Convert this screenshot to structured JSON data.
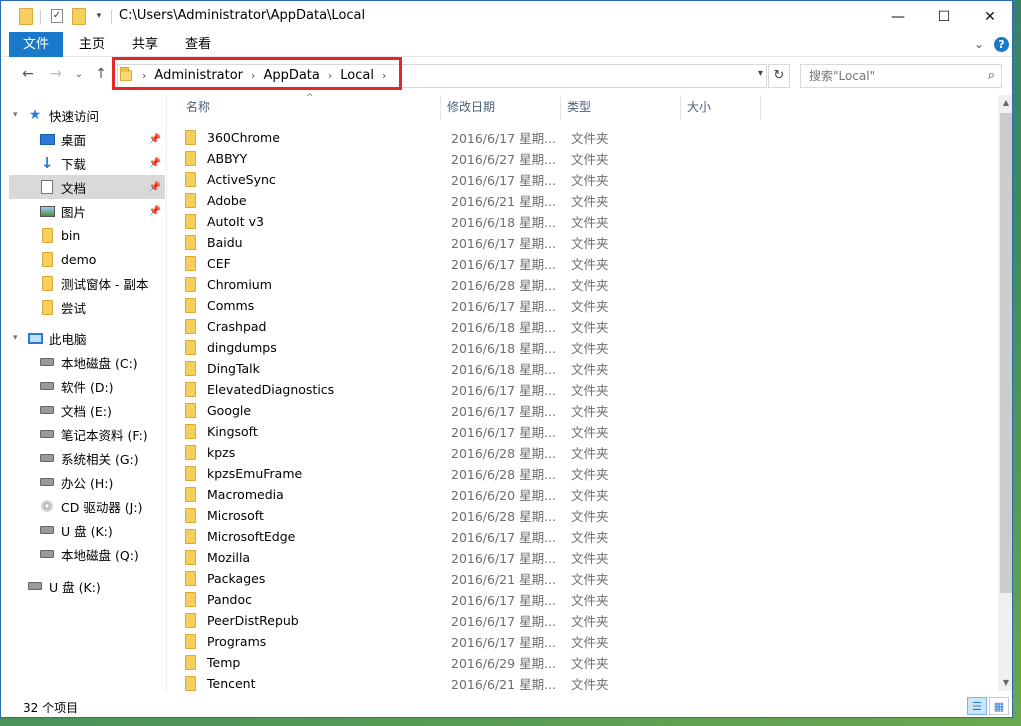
{
  "window": {
    "path_title": "C:\\Users\\Administrator\\AppData\\Local",
    "minimize": "—",
    "maximize": "☐",
    "close": "✕"
  },
  "ribbon": {
    "tabs": [
      "文件",
      "主页",
      "共享",
      "查看"
    ],
    "expand": "⌄",
    "help": "?"
  },
  "nav": {
    "back": "←",
    "forward": "→",
    "recent": "⌄",
    "up": "↑",
    "breadcrumbs": [
      "Administrator",
      "AppData",
      "Local"
    ],
    "refresh": "↻",
    "search_placeholder": "搜索\"Local\"",
    "search_icon": "⌕"
  },
  "sidebar": {
    "quick_access": "快速访问",
    "quick_items": [
      {
        "label": "桌面",
        "icon": "desktop-icon",
        "pinned": true
      },
      {
        "label": "下载",
        "icon": "download-icon",
        "pinned": true
      },
      {
        "label": "文档",
        "icon": "document-icon",
        "pinned": true,
        "selected": true
      },
      {
        "label": "图片",
        "icon": "picture-icon",
        "pinned": true
      },
      {
        "label": "bin",
        "icon": "folder-icon"
      },
      {
        "label": "demo",
        "icon": "folder-icon"
      },
      {
        "label": "测试窗体 - 副本",
        "icon": "folder-icon"
      },
      {
        "label": "尝试",
        "icon": "folder-icon"
      }
    ],
    "this_pc": "此电脑",
    "drives": [
      "本地磁盘 (C:)",
      "软件 (D:)",
      "文档 (E:)",
      "笔记本资料 (F:)",
      "系统相关 (G:)",
      "办公 (H:)",
      "CD 驱动器 (J:)",
      "U 盘 (K:)",
      "本地磁盘 (Q:)"
    ],
    "usb": "U 盘 (K:)"
  },
  "columns": {
    "name": "名称",
    "date": "修改日期",
    "type": "类型",
    "size": "大小",
    "sort_indicator": "^"
  },
  "files": [
    {
      "name": "360Chrome",
      "date": "2016/6/17 星期...",
      "type": "文件夹"
    },
    {
      "name": "ABBYY",
      "date": "2016/6/27 星期...",
      "type": "文件夹"
    },
    {
      "name": "ActiveSync",
      "date": "2016/6/17 星期...",
      "type": "文件夹"
    },
    {
      "name": "Adobe",
      "date": "2016/6/21 星期...",
      "type": "文件夹"
    },
    {
      "name": "AutoIt v3",
      "date": "2016/6/18 星期...",
      "type": "文件夹"
    },
    {
      "name": "Baidu",
      "date": "2016/6/17 星期...",
      "type": "文件夹"
    },
    {
      "name": "CEF",
      "date": "2016/6/17 星期...",
      "type": "文件夹"
    },
    {
      "name": "Chromium",
      "date": "2016/6/28 星期...",
      "type": "文件夹"
    },
    {
      "name": "Comms",
      "date": "2016/6/17 星期...",
      "type": "文件夹"
    },
    {
      "name": "Crashpad",
      "date": "2016/6/18 星期...",
      "type": "文件夹"
    },
    {
      "name": "dingdumps",
      "date": "2016/6/18 星期...",
      "type": "文件夹"
    },
    {
      "name": "DingTalk",
      "date": "2016/6/18 星期...",
      "type": "文件夹"
    },
    {
      "name": "ElevatedDiagnostics",
      "date": "2016/6/17 星期...",
      "type": "文件夹"
    },
    {
      "name": "Google",
      "date": "2016/6/17 星期...",
      "type": "文件夹"
    },
    {
      "name": "Kingsoft",
      "date": "2016/6/17 星期...",
      "type": "文件夹"
    },
    {
      "name": "kpzs",
      "date": "2016/6/28 星期...",
      "type": "文件夹"
    },
    {
      "name": "kpzsEmuFrame",
      "date": "2016/6/28 星期...",
      "type": "文件夹"
    },
    {
      "name": "Macromedia",
      "date": "2016/6/20 星期...",
      "type": "文件夹"
    },
    {
      "name": "Microsoft",
      "date": "2016/6/28 星期...",
      "type": "文件夹"
    },
    {
      "name": "MicrosoftEdge",
      "date": "2016/6/17 星期...",
      "type": "文件夹"
    },
    {
      "name": "Mozilla",
      "date": "2016/6/17 星期...",
      "type": "文件夹"
    },
    {
      "name": "Packages",
      "date": "2016/6/21 星期...",
      "type": "文件夹"
    },
    {
      "name": "Pandoc",
      "date": "2016/6/17 星期...",
      "type": "文件夹"
    },
    {
      "name": "PeerDistRepub",
      "date": "2016/6/17 星期...",
      "type": "文件夹"
    },
    {
      "name": "Programs",
      "date": "2016/6/17 星期...",
      "type": "文件夹"
    },
    {
      "name": "Temp",
      "date": "2016/6/29 星期...",
      "type": "文件夹"
    },
    {
      "name": "Tencent",
      "date": "2016/6/21 星期...",
      "type": "文件夹"
    }
  ],
  "status": {
    "item_count": "32 个项目"
  },
  "colors": {
    "accent": "#1979ca",
    "highlight_box": "#e8252a",
    "selected_bg": "#d9d9d9"
  }
}
